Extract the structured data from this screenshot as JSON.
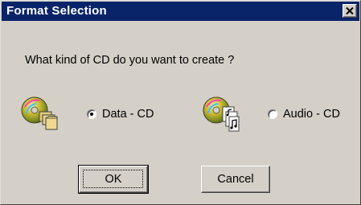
{
  "window": {
    "title": "Format Selection",
    "close_icon": "close-x-icon"
  },
  "prompt": "What kind of CD do you want to create ?",
  "options": [
    {
      "label": "Data - CD",
      "icon": "data-cd-icon",
      "selected": true
    },
    {
      "label": "Audio - CD",
      "icon": "audio-cd-icon",
      "selected": false
    }
  ],
  "buttons": {
    "ok_label": "OK",
    "cancel_label": "Cancel"
  },
  "colors": {
    "titlebar": "#0a246a",
    "face": "#d4d0c8"
  }
}
